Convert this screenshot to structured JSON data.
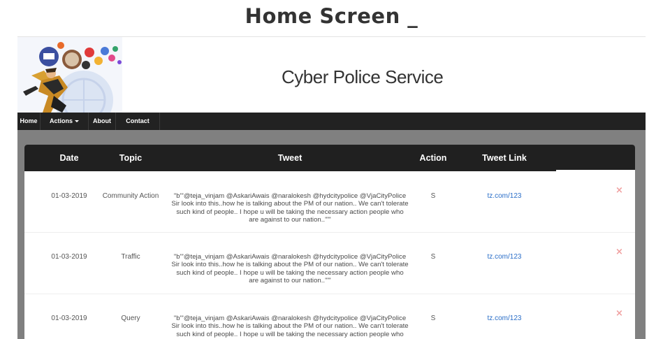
{
  "page": {
    "title": "Home Screen _"
  },
  "banner": {
    "site_name": "Cyber Police Service"
  },
  "nav": {
    "items": [
      {
        "label": "Home"
      },
      {
        "label": "Actions"
      },
      {
        "label": "About"
      },
      {
        "label": "Contact"
      }
    ]
  },
  "table": {
    "headers": [
      "Date",
      "Topic",
      "Tweet",
      "Action",
      "Tweet Link"
    ],
    "rows": [
      {
        "date": "01-03-2019",
        "topic": "Community Action",
        "tweet": "\"b'\"@teja_vinjam @AskariAwais @naralokesh @hydcitypolice @VjaCityPolice Sir look into this..how he is talking about the PM of our nation.. We can't tolerate such kind of people.. I hope u will be taking the necessary action people who are against to our nation..'\"\"",
        "action": "S",
        "link": "tz.com/123",
        "delete": "×"
      },
      {
        "date": "01-03-2019",
        "topic": "Traffic",
        "tweet": "\"b'\"@teja_vinjam @AskariAwais @naralokesh @hydcitypolice @VjaCityPolice Sir look into this..how he is talking about the PM of our nation.. We can't tolerate such kind of people.. I hope u will be taking the necessary action people who are against to our nation..'\"\"",
        "action": "S",
        "link": "tz.com/123",
        "delete": "×"
      },
      {
        "date": "01-03-2019",
        "topic": "Query",
        "tweet": "\"b'\"@teja_vinjam @AskariAwais @naralokesh @hydcitypolice @VjaCityPolice Sir look into this..how he is talking about the PM of our nation.. We can't tolerate such kind of people.. I hope u will be taking the necessary action people who are against to our nation..'\"\"",
        "action": "S",
        "link": "tz.com/123",
        "delete": "×"
      }
    ]
  },
  "colors": {
    "navbar": "#222222",
    "content_bg": "#808080",
    "table_header": "#202020",
    "link": "#2a6ec8",
    "delete_icon": "#f0a0a0"
  }
}
